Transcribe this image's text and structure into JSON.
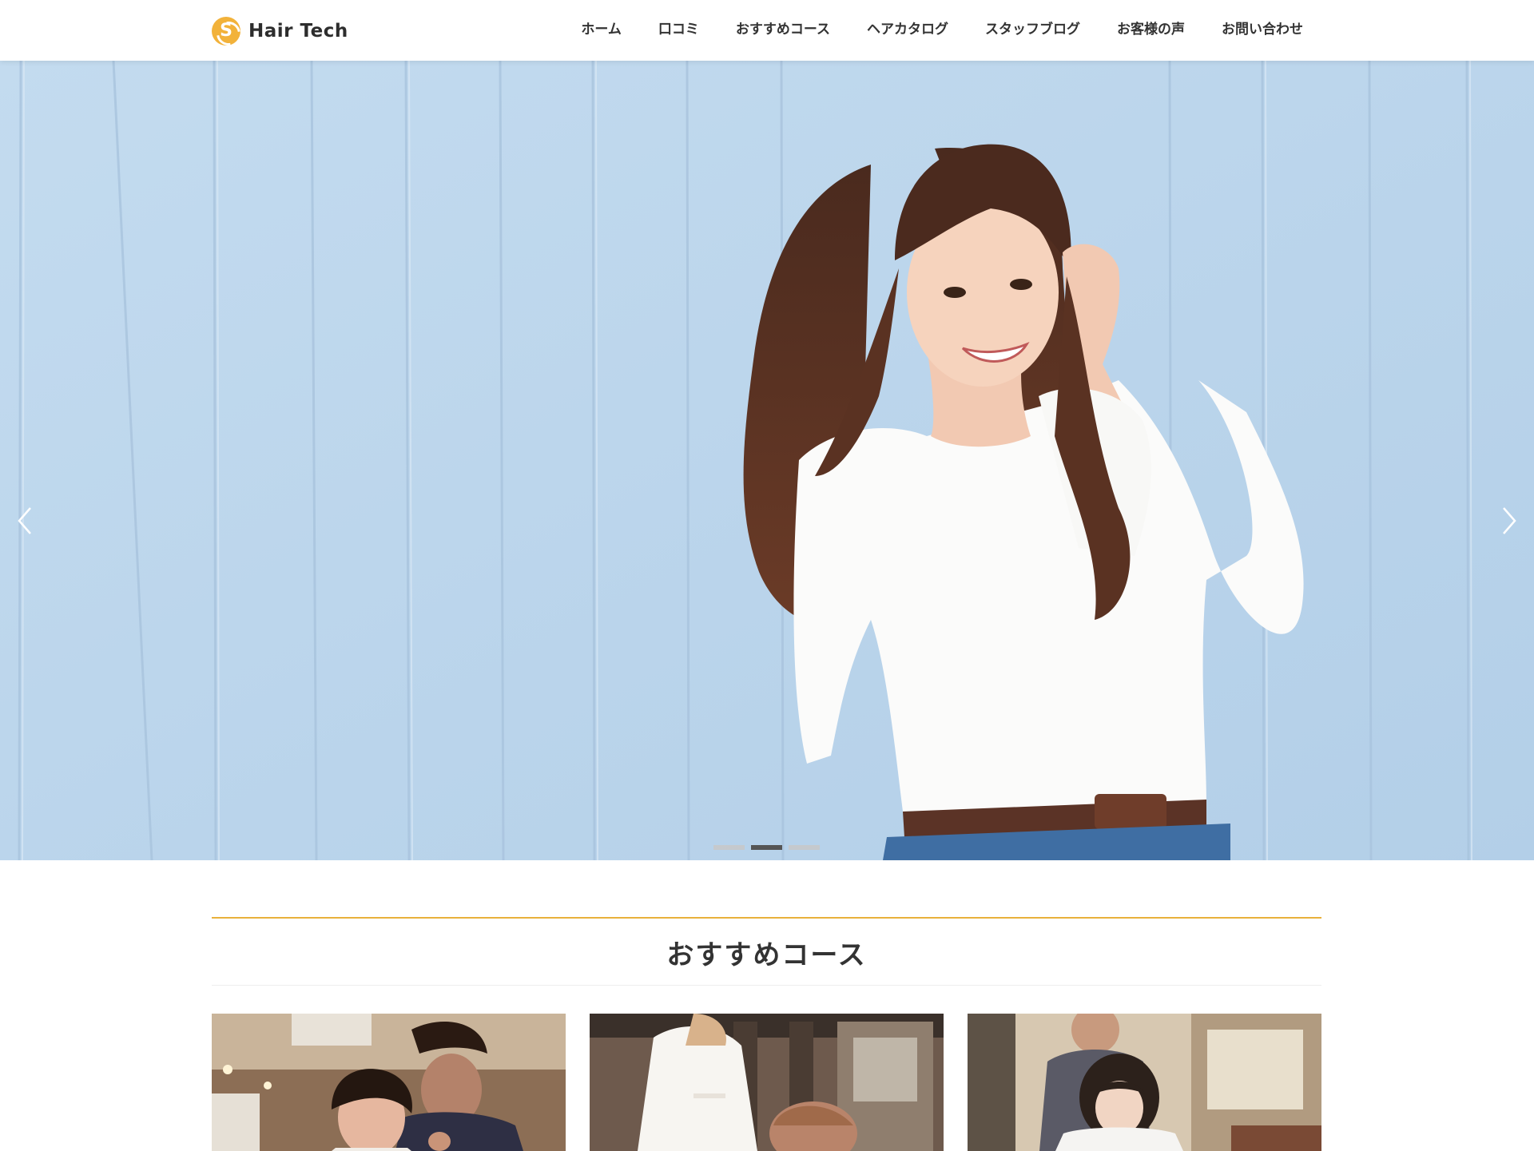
{
  "header": {
    "logo_mark": "S",
    "logo_text": "Hair Tech",
    "nav": [
      {
        "label": "ホーム"
      },
      {
        "label": "口コミ"
      },
      {
        "label": "おすすめコース"
      },
      {
        "label": "ヘアカタログ"
      },
      {
        "label": "スタッフブログ"
      },
      {
        "label": "お客様の声"
      },
      {
        "label": "お問い合わせ"
      }
    ]
  },
  "hero": {
    "icons": {
      "prev": "chevron-left-icon",
      "next": "chevron-right-icon"
    },
    "slides_count": 3,
    "active_slide": 2
  },
  "courses_section": {
    "title": "おすすめコース"
  },
  "colors": {
    "accent": "#e9b13b",
    "logo": "#f2b23a",
    "hero_background": "#bcd6ec",
    "text": "#333333"
  }
}
